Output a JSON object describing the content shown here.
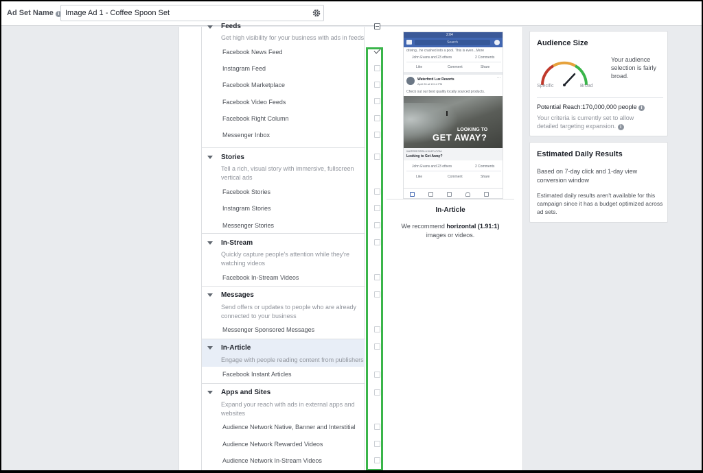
{
  "header": {
    "ad_set_label": "Ad Set Name",
    "ad_set_name_value": "Image Ad 1 - Coffee Spoon Set"
  },
  "placements": {
    "groups": [
      {
        "title": "Feeds",
        "description": "Get high visibility for your business with ads in feeds",
        "items": [
          "Facebook News Feed",
          "Instagram Feed",
          "Facebook Marketplace",
          "Facebook Video Feeds",
          "Facebook Right Column",
          "Messenger Inbox"
        ]
      },
      {
        "title": "Stories",
        "description": "Tell a rich, visual story with immersive, fullscreen vertical ads",
        "items": [
          "Facebook Stories",
          "Instagram Stories",
          "Messenger Stories"
        ]
      },
      {
        "title": "In-Stream",
        "description": "Quickly capture people's attention while they're watching videos",
        "items": [
          "Facebook In-Stream Videos"
        ]
      },
      {
        "title": "Messages",
        "description": "Send offers or updates to people who are already connected to your business",
        "items": [
          "Messenger Sponsored Messages"
        ]
      },
      {
        "title": "In-Article",
        "description": "Engage with people reading content from publishers",
        "items": [
          "Facebook Instant Articles"
        ]
      },
      {
        "title": "Apps and Sites",
        "description": "Expand your reach with ads in external apps and websites",
        "items": [
          "Audience Network Native, Banner and Interstitial",
          "Audience Network Rewarded Videos",
          "Audience Network In-Stream Videos"
        ]
      }
    ],
    "checked_item": "Facebook News Feed",
    "highlighted_group": "In-Article"
  },
  "preview": {
    "phone": {
      "time": "2:04",
      "search": "Search",
      "prev_post_text": "driving...he crashed into a pool. This is even...More",
      "reactions": "John Evans and 23 others",
      "comments": "2 Comments",
      "like": "Like",
      "comment": "Comment",
      "share": "Share",
      "page_name": "Waterford Lux Resorts",
      "page_meta": "April 26 at 10:14 PM",
      "post_text": "Check out our best quality locally sourced products.",
      "image_line1": "LOOKING TO",
      "image_line2": "GET AWAY?",
      "link_domain": "WATERFORDLUXURY.COM",
      "link_title": "Looking to Get Away?",
      "reactions2": "John Evans and 23 others",
      "comments2": "2 Comments"
    },
    "placement_title": "In-Article",
    "rec_prefix": "We recommend",
    "rec_bold": "horizontal (1.91:1)",
    "rec_suffix": "images or videos."
  },
  "audience": {
    "title": "Audience Size",
    "gauge_low": "Specific",
    "gauge_high": "Broad",
    "gauge_level": 0.72,
    "status": "Your audience selection is fairly broad.",
    "reach": "Potential Reach:170,000,000 people",
    "criteria": "Your criteria is currently set to allow detailed targeting expansion."
  },
  "daily": {
    "title": "Estimated Daily Results",
    "basis": "Based on 7-day click and 1-day view conversion window",
    "note": "Estimated daily results aren't available for this campaign since it has a budget optimized across ad sets."
  },
  "colors": {
    "highlight_box": "#3ab54a",
    "facebook_blue": "#4267b2"
  }
}
